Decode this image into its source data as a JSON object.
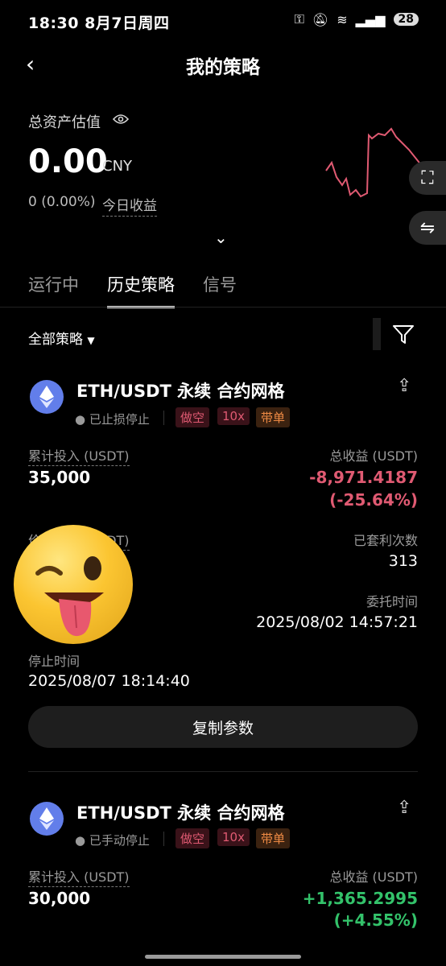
{
  "status_bar": {
    "time_date": "18:30  8月7日周四",
    "battery": "28"
  },
  "header": {
    "title": "我的策略"
  },
  "assets": {
    "label": "总资产估值",
    "value": "0.00",
    "currency": "CNY",
    "pnl": "0 (0.00%)",
    "pnl_label": "今日收益"
  },
  "tabs": [
    {
      "label": "运行中"
    },
    {
      "label": "历史策略"
    },
    {
      "label": "信号"
    }
  ],
  "filter": {
    "label": "全部策略"
  },
  "cards": [
    {
      "title": "ETH/USDT 永续 合约网格",
      "status": "已止损停止",
      "tags": [
        "做空",
        "10x",
        "带单"
      ],
      "invest_label": "累计投入 (USDT)",
      "invest": "35,000",
      "profit_label": "总收益 (USDT)",
      "profit": "-8,971.4187",
      "profit_pct": "(-25.64%)",
      "price_label": "价格区间 (USDT)",
      "arb_label": "已套利次数",
      "arb": "313",
      "order_time_label": "委托时间",
      "order_time": "2025/08/02 14:57:21",
      "stop_time_label": "停止时间",
      "stop_time": "2025/08/07 18:14:40",
      "copy_button": "复制参数"
    },
    {
      "title": "ETH/USDT 永续 合约网格",
      "status": "已手动停止",
      "tags": [
        "做空",
        "10x",
        "带单"
      ],
      "invest_label": "累计投入 (USDT)",
      "invest": "30,000",
      "profit_label": "总收益 (USDT)",
      "profit": "+1,365.2995",
      "profit_pct": "(+4.55%)"
    }
  ],
  "colors": {
    "negative": "#e05a72",
    "positive": "#33c26a",
    "sparkline": "#e05a72"
  }
}
